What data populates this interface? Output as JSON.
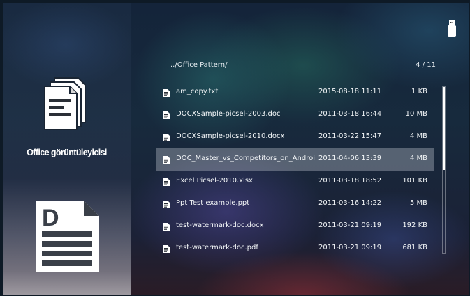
{
  "app": {
    "title": "Office görüntüleyicisi"
  },
  "browser": {
    "path": "../Office Pattern/",
    "page_count": "4 / 11"
  },
  "files": [
    {
      "name": "am_copy.txt",
      "date": "2015-08-18 11:11",
      "size": "1 KB",
      "selected": false
    },
    {
      "name": "DOCXSample-picsel-2003.doc",
      "date": "2011-03-18 16:44",
      "size": "10 MB",
      "selected": false
    },
    {
      "name": "DOCXSample-picsel-2010.docx",
      "date": "2011-03-22 15:47",
      "size": "4 MB",
      "selected": false
    },
    {
      "name": "DOC_Master_vs_Competitors_on_Androi",
      "date": "2011-04-06 13:39",
      "size": "4 MB",
      "selected": true
    },
    {
      "name": "Excel Picsel-2010.xlsx",
      "date": "2011-03-18 18:52",
      "size": "101 KB",
      "selected": false
    },
    {
      "name": "Ppt Test example.ppt",
      "date": "2011-03-16 14:22",
      "size": "5 MB",
      "selected": false
    },
    {
      "name": "test-watermark-doc.docx",
      "date": "2011-03-21 09:19",
      "size": "192 KB",
      "selected": false
    },
    {
      "name": "test-watermark-doc.pdf",
      "date": "2011-03-21 09:19",
      "size": "681 KB",
      "selected": false
    }
  ],
  "scrollbar": {
    "position_fraction": 0.0,
    "visible_fraction": 0.5
  },
  "icons": {
    "app": "documents-icon",
    "preview": "document-d-icon",
    "usb": "usb-drive-icon",
    "file": "file-document-icon"
  },
  "colors": {
    "accent": "#ffffff",
    "selection": "#bec3cd"
  }
}
